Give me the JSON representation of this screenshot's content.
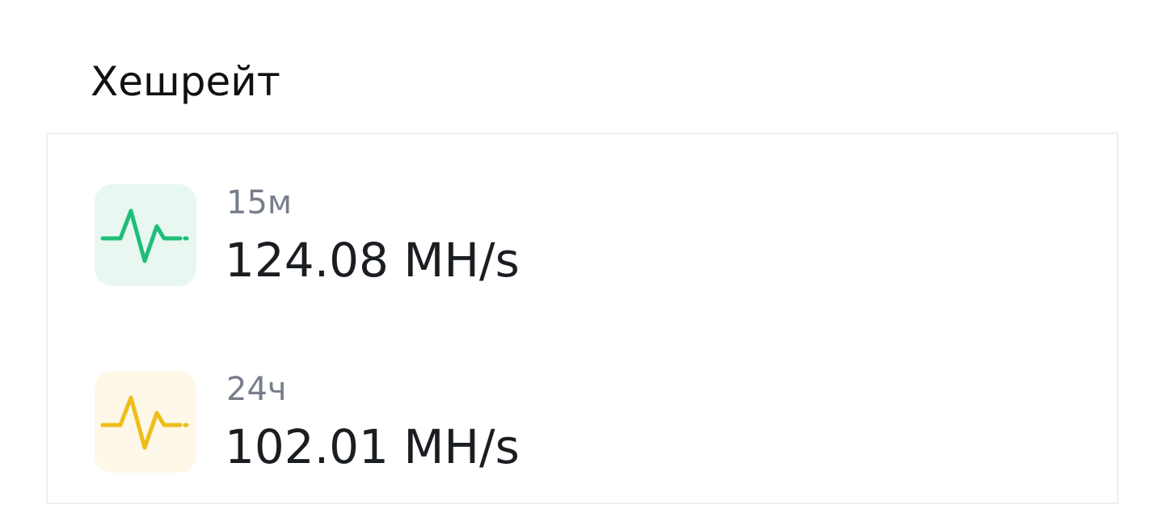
{
  "section": {
    "title": "Хешрейт"
  },
  "hashrate": {
    "items": [
      {
        "period": "15м",
        "value": "124.08 MH/s",
        "icon": "pulse-icon",
        "icon_color": "#1ebe78",
        "icon_bg": "#e8f8f0"
      },
      {
        "period": "24ч",
        "value": "102.01 MH/s",
        "icon": "pulse-icon",
        "icon_color": "#efbd1a",
        "icon_bg": "#fdf8e7"
      }
    ]
  }
}
